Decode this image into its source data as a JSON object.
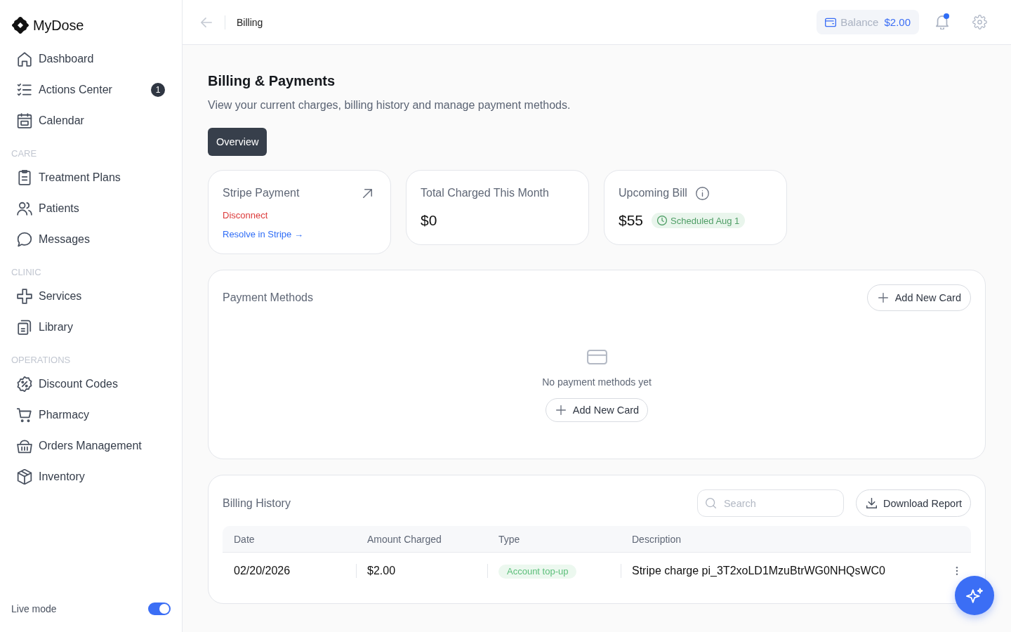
{
  "sidebar": {
    "brand": "MyDose",
    "groups": [
      {
        "items": [
          {
            "label": "Dashboard",
            "selected": false
          },
          {
            "label": "Actions Center",
            "badge": "1",
            "selected": false
          },
          {
            "label": "Calendar",
            "selected": false
          }
        ]
      },
      {
        "heading": "CARE",
        "items": [
          {
            "label": "Treatment Plans",
            "selected": false
          },
          {
            "label": "Patients",
            "selected": false
          },
          {
            "label": "Messages",
            "selected": false
          }
        ]
      },
      {
        "heading": "CLINIC",
        "items": [
          {
            "label": "Services",
            "selected": false
          },
          {
            "label": "Library",
            "selected": false
          }
        ]
      },
      {
        "heading": "OPERATIONS",
        "items": [
          {
            "label": "Discount Codes",
            "selected": false
          },
          {
            "label": "Pharmacy",
            "selected": false
          },
          {
            "label": "Orders Management",
            "selected": false
          },
          {
            "label": "Inventory",
            "selected": false
          }
        ]
      }
    ],
    "live_mode": {
      "label": "Live mode",
      "on": true
    }
  },
  "topbar": {
    "title": "Billing",
    "balance": {
      "label": "Balance",
      "amount": "$2.00"
    },
    "notifications": {
      "unread": true
    }
  },
  "page": {
    "title": "Billing & Payments",
    "subtitle": "View your current charges, billing history and manage payment methods.",
    "tabs": [
      {
        "label": "Overview",
        "selected": true
      }
    ]
  },
  "summary_cards": [
    {
      "kind": "integration",
      "title": "Stripe Payment",
      "action": "Disconnect",
      "link": "Resolve in Stripe →"
    },
    {
      "kind": "metric",
      "title": "Total Charged This Month",
      "value": "$0"
    },
    {
      "kind": "scheduled",
      "title": "Upcoming Bill",
      "value": "$55",
      "badge": "Scheduled Aug 1"
    }
  ],
  "payment_methods": {
    "title": "Payment Methods",
    "add_button": "Add New Card",
    "empty_state": {
      "text": "No payment methods yet",
      "button": "Add New Card"
    }
  },
  "billing_history": {
    "title": "Billing History",
    "search": {
      "placeholder": "Search"
    },
    "download_button": "Download Report",
    "columns": [
      "Date",
      "Amount Charged",
      "Type",
      "Description"
    ],
    "rows": [
      {
        "date": "02/20/2026",
        "amount": "$2.00",
        "type": "Account top-up",
        "description": "Stripe charge pi_3T2xoLD1MzuBtrWG0NHQsWC0"
      }
    ]
  }
}
